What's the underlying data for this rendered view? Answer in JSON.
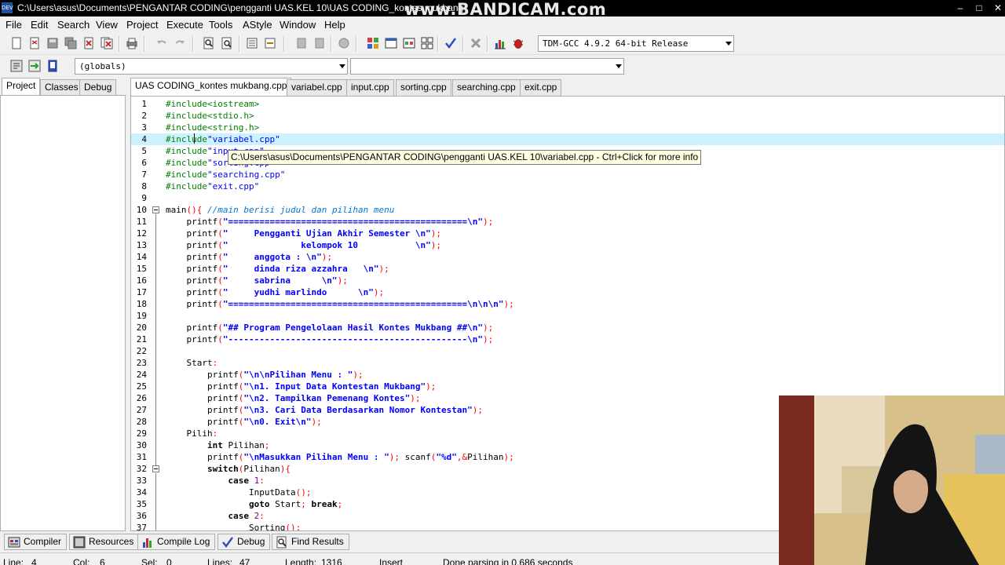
{
  "titlebar": {
    "title": "C:\\Users\\asus\\Documents\\PENGANTAR CODING\\pengganti UAS.KEL 10\\UAS CODING_kontes mukbang",
    "watermark": "www.BANDICAM.com",
    "app_icon_text": "DEV"
  },
  "menu": [
    "File",
    "Edit",
    "Search",
    "View",
    "Project",
    "Execute",
    "Tools",
    "AStyle",
    "Window",
    "Help"
  ],
  "toolbar": {
    "compiler_select": "TDM-GCC 4.9.2 64-bit Release",
    "scope_select": "(globals)",
    "member_select": ""
  },
  "left_tabs": [
    "Project",
    "Classes",
    "Debug"
  ],
  "file_tabs": [
    "UAS CODING_kontes mukbang.cpp",
    "variabel.cpp",
    "input.cpp",
    "sorting.cpp",
    "searching.cpp",
    "exit.cpp"
  ],
  "tooltip": "C:\\Users\\asus\\Documents\\PENGANTAR CODING\\pengganti UAS.KEL 10\\variabel.cpp - Ctrl+Click for more info",
  "editor": {
    "current_line": 4,
    "lines": [
      {
        "n": 1,
        "text": "#include<iostream>"
      },
      {
        "n": 2,
        "text": "#include<stdio.h>"
      },
      {
        "n": 3,
        "text": "#include<string.h>"
      },
      {
        "n": 4,
        "text": "#include\"variabel.cpp\""
      },
      {
        "n": 5,
        "text": "#include\"input.cpp\""
      },
      {
        "n": 6,
        "text": "#include\"sorting.cpp\""
      },
      {
        "n": 7,
        "text": "#include\"searching.cpp\""
      },
      {
        "n": 8,
        "text": "#include\"exit.cpp\""
      },
      {
        "n": 9,
        "text": ""
      },
      {
        "n": 10,
        "text": "main(){ //main berisi judul dan pilihan menu"
      },
      {
        "n": 11,
        "text": "    printf(\"==============================================\\n\");"
      },
      {
        "n": 12,
        "text": "    printf(\"     Pengganti Ujian Akhir Semester \\n\");"
      },
      {
        "n": 13,
        "text": "    printf(\"              kelompok 10           \\n\");"
      },
      {
        "n": 14,
        "text": "    printf(\"     anggota : \\n\");"
      },
      {
        "n": 15,
        "text": "    printf(\"     dinda riza azzahra   \\n\");"
      },
      {
        "n": 16,
        "text": "    printf(\"     sabrina      \\n\");"
      },
      {
        "n": 17,
        "text": "    printf(\"     yudhi marlindo      \\n\");"
      },
      {
        "n": 18,
        "text": "    printf(\"==============================================\\n\\n\\n\");"
      },
      {
        "n": 19,
        "text": ""
      },
      {
        "n": 20,
        "text": "    printf(\"## Program Pengelolaan Hasil Kontes Mukbang ##\\n\");"
      },
      {
        "n": 21,
        "text": "    printf(\"----------------------------------------------\\n\");"
      },
      {
        "n": 22,
        "text": ""
      },
      {
        "n": 23,
        "text": "    Start:"
      },
      {
        "n": 24,
        "text": "        printf(\"\\n\\nPilihan Menu : \");"
      },
      {
        "n": 25,
        "text": "        printf(\"\\n1. Input Data Kontestan Mukbang\");"
      },
      {
        "n": 26,
        "text": "        printf(\"\\n2. Tampilkan Pemenang Kontes\");"
      },
      {
        "n": 27,
        "text": "        printf(\"\\n3. Cari Data Berdasarkan Nomor Kontestan\");"
      },
      {
        "n": 28,
        "text": "        printf(\"\\n0. Exit\\n\");"
      },
      {
        "n": 29,
        "text": "    Pilih:"
      },
      {
        "n": 30,
        "text": "        int Pilihan;"
      },
      {
        "n": 31,
        "text": "        printf(\"\\nMasukkan Pilihan Menu : \"); scanf(\"%d\",&Pilihan);"
      },
      {
        "n": 32,
        "text": "        switch(Pilihan){"
      },
      {
        "n": 33,
        "text": "            case 1:"
      },
      {
        "n": 34,
        "text": "                InputData();"
      },
      {
        "n": 35,
        "text": "                goto Start; break;"
      },
      {
        "n": 36,
        "text": "            case 2:"
      },
      {
        "n": 37,
        "text": "                Sorting();"
      }
    ]
  },
  "bottom_tabs": [
    {
      "label": "Compiler",
      "icon": "compiler-icon"
    },
    {
      "label": "Resources",
      "icon": "resources-icon"
    },
    {
      "label": "Compile Log",
      "icon": "compile-log-icon"
    },
    {
      "label": "Debug",
      "icon": "debug-check-icon"
    },
    {
      "label": "Find Results",
      "icon": "find-results-icon"
    }
  ],
  "status": {
    "line_label": "Line:",
    "line": "4",
    "col_label": "Col:",
    "col": "6",
    "sel_label": "Sel:",
    "sel": "0",
    "lines_label": "Lines:",
    "lines": "47",
    "length_label": "Length:",
    "length": "1316",
    "mode": "Insert",
    "message": "Done parsing in 0.686 seconds"
  },
  "colors": {
    "preprocessor": "#008000",
    "string": "#0000ff",
    "comment": "#0078d7",
    "keyword": "#000000",
    "symbol": "#ff0000",
    "number": "#800080",
    "current_line_bg": "#ccf2ff"
  }
}
